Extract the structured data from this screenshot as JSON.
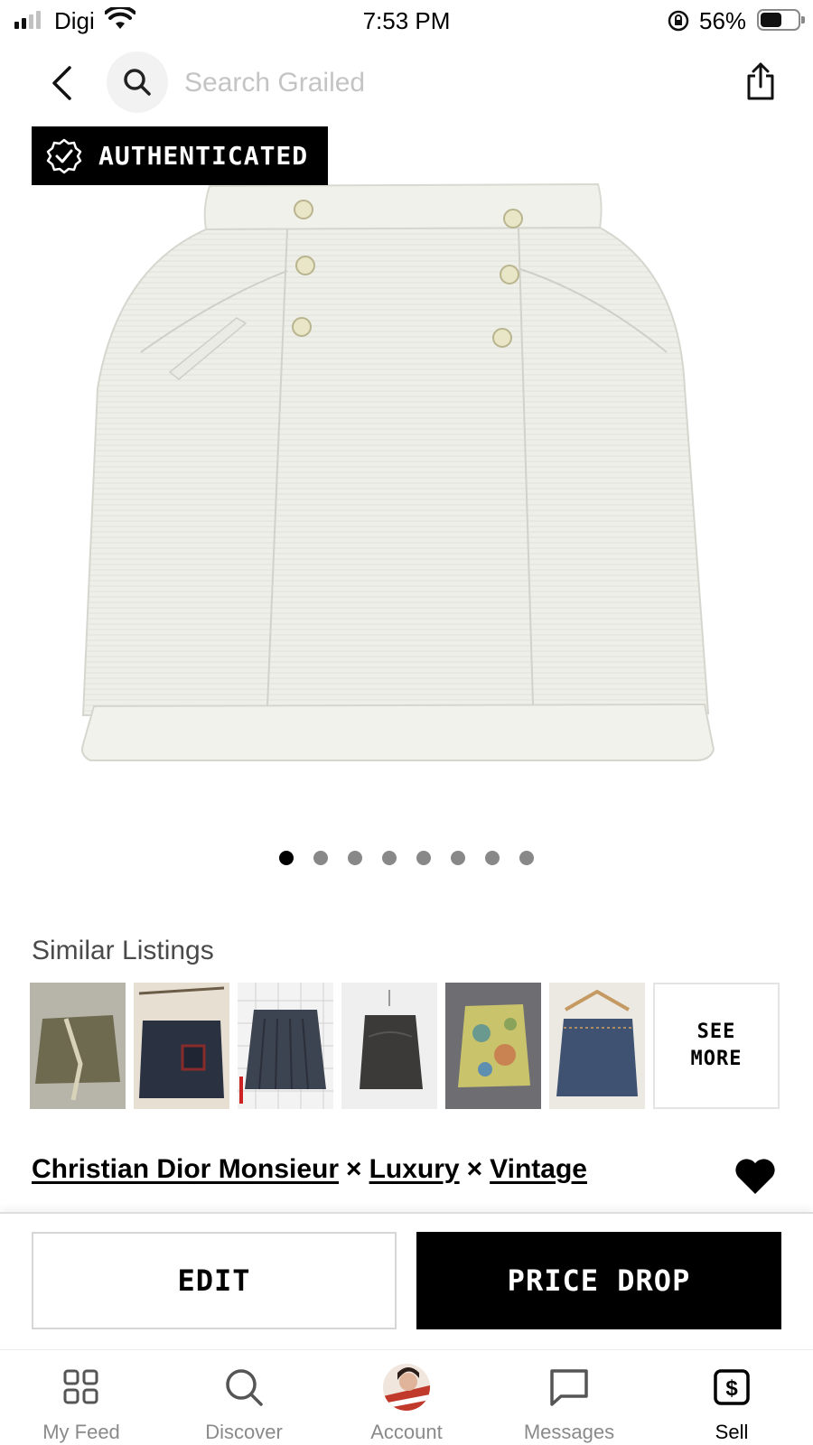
{
  "status_bar": {
    "carrier": "Digi",
    "time": "7:53 PM",
    "battery_percent": "56%",
    "signal_bars": 2,
    "battery_level": 0.56
  },
  "top_nav": {
    "search_placeholder": "Search Grailed",
    "icons": [
      "chevron-left-icon",
      "search-icon",
      "share-icon"
    ]
  },
  "listing": {
    "badge": "AUTHENTICATED",
    "image_count": 8,
    "active_image": 1,
    "designers": [
      "Christian Dior Monsieur",
      "Luxury",
      "Vintage"
    ],
    "separator": "×",
    "favorited": true
  },
  "similar": {
    "title": "Similar Listings",
    "see_more": "SEE\nMORE",
    "thumbnails": [
      {
        "name": "khaki-wrap-skirt",
        "color": "#6e6a4f"
      },
      {
        "name": "dark-denim-skirt",
        "color": "#2a3242"
      },
      {
        "name": "pleated-skirt",
        "color": "#3c4351"
      },
      {
        "name": "leather-skirt",
        "color": "#3b3a38"
      },
      {
        "name": "paisley-skirt",
        "color": "#c9c36b"
      },
      {
        "name": "denim-skirt",
        "color": "#3f5272"
      }
    ]
  },
  "actions": {
    "edit": "EDIT",
    "price_drop": "PRICE DROP"
  },
  "tab_bar": {
    "items": [
      {
        "label": "My Feed",
        "icon": "grid-icon"
      },
      {
        "label": "Discover",
        "icon": "search-icon"
      },
      {
        "label": "Account",
        "icon": "avatar"
      },
      {
        "label": "Messages",
        "icon": "chat-icon"
      },
      {
        "label": "Sell",
        "icon": "dollar-tag-icon"
      }
    ],
    "active": "Sell"
  },
  "colors": {
    "black": "#000000",
    "placeholder_gray": "#c4c4c4",
    "dot_inactive": "#888888"
  }
}
